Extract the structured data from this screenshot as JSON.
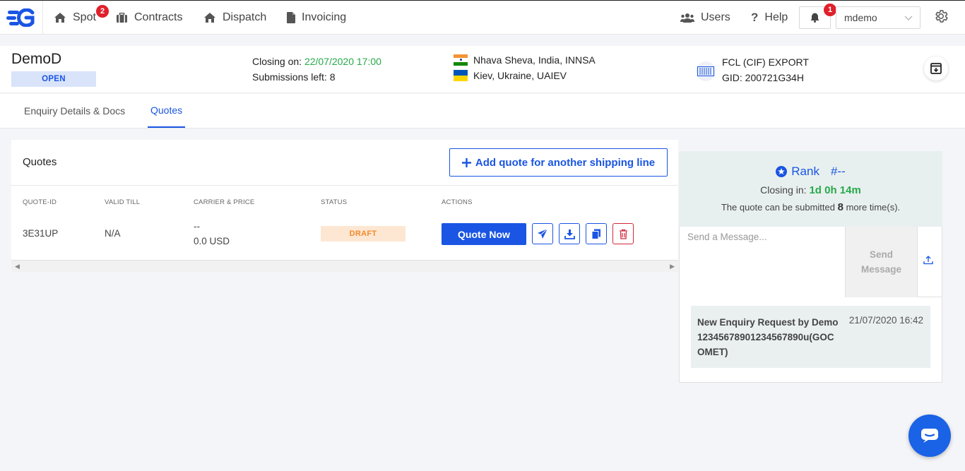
{
  "nav": {
    "items": [
      {
        "label": "Spot",
        "badge": "2",
        "icon": "home-icon"
      },
      {
        "label": "Contracts",
        "icon": "briefcase-icon"
      },
      {
        "label": "Dispatch",
        "icon": "home-icon"
      },
      {
        "label": "Invoicing",
        "icon": "document-icon"
      }
    ],
    "users_label": "Users",
    "help_label": "Help",
    "notification_count": "1",
    "username": "mdemo"
  },
  "enquiry": {
    "name": "DemoD",
    "status": "OPEN",
    "closing_label": "Closing on:",
    "closing_value": "22/07/2020 17:00",
    "submissions_label": "Submissions left:",
    "submissions_value": "8",
    "origin": "Nhava Sheva, India, INNSA",
    "destination": "Kiev, Ukraine, UAIEV",
    "shipment_type": "FCL (CIF) EXPORT",
    "gid": "GID: 200721G34H"
  },
  "tabs": [
    {
      "label": "Enquiry Details & Docs",
      "active": false
    },
    {
      "label": "Quotes",
      "active": true
    }
  ],
  "quotes": {
    "title": "Quotes",
    "add_button": "Add quote for another shipping line",
    "columns": [
      "QUOTE-ID",
      "VALID TILL",
      "CARRIER & PRICE",
      "STATUS",
      "ACTIONS"
    ],
    "rows": [
      {
        "id": "3E31UP",
        "valid_till": "N/A",
        "carrier": "--",
        "price": "0.0 USD",
        "status": "DRAFT",
        "action_label": "Quote Now"
      }
    ]
  },
  "rank": {
    "label": "Rank",
    "value": "#--",
    "closing_in_label": "Closing in:",
    "closing_in_value": "1d 0h 14m",
    "submit_prefix": "The quote can be submitted",
    "submit_count": "8",
    "submit_suffix": "more time(s)."
  },
  "message": {
    "placeholder": "Send a Message...",
    "send_line1": "Send",
    "send_line2": "Message"
  },
  "log": {
    "text": "New Enquiry Request by Demo12345678901234567890u(GOCOMET)",
    "time": "21/07/2020 16:42"
  },
  "colors": {
    "primary": "#1a55e3",
    "green": "#27a94a",
    "badge_red": "#e0202b",
    "draft_bg": "#fde7d3",
    "draft_text": "#f28a2a",
    "open_bg": "#d9e4fb"
  }
}
